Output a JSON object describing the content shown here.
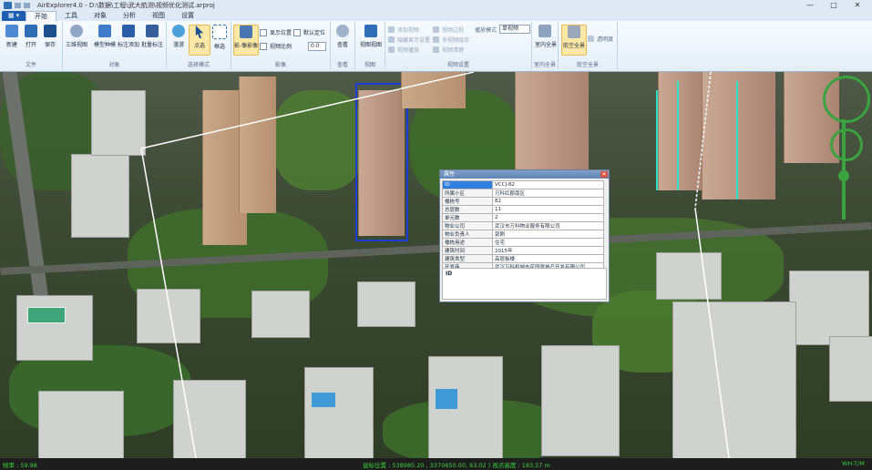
{
  "window": {
    "title": "AirExplorer4.0 - D:\\数据\\工程\\武大航测\\视频优化测试.arproj",
    "minimize": "—",
    "maximize": "□",
    "close": "✕"
  },
  "menu": {
    "file": "▦ ▾",
    "tabs": [
      "开始",
      "工具",
      "对象",
      "分析",
      "视图",
      "设置"
    ]
  },
  "ribbon": {
    "groups": {
      "file": "文件",
      "object": "对象",
      "select_mode": "选择模式",
      "image": "影像",
      "view": "查看",
      "viewpoint": "视图",
      "view_settings": "视频设置",
      "indoor": "室内全景",
      "aerial": "航空全景"
    },
    "buttons": {
      "new": "新建",
      "open": "打开",
      "save": "保存",
      "3d_view": "三维视图",
      "model_wire": "模型种模",
      "label_add": "标注添加",
      "batch_label": "批量标注",
      "roam": "漫游",
      "point_select": "点选",
      "frame_select": "框选",
      "image_mosaic": "影-像影像",
      "view_btn": "查看",
      "view_view": "视图视图",
      "indoor_pano": "室内全景",
      "aerial_pano": "航空全景",
      "transparent": "透明度"
    },
    "checks": {
      "show_position": "显示位置",
      "default_position": "默认定位",
      "view_scale": "视频比例"
    },
    "spin_value": "0.0",
    "view_settings_items": [
      "添加视频",
      "隐藏显示设置",
      "视频播放",
      "视频过程",
      "多视频组合",
      "视频清理",
      "播放模式"
    ],
    "play_mode": "单视频"
  },
  "popup": {
    "title": "属性",
    "close": "✕",
    "rows": [
      {
        "k": "ID",
        "v": "VCCJ-82",
        "highlight": true
      },
      {
        "k": "所属小区",
        "v": "万科红郡南区"
      },
      {
        "k": "楼栋号",
        "v": "82"
      },
      {
        "k": "总层数",
        "v": "11"
      },
      {
        "k": "单元数",
        "v": "2"
      },
      {
        "k": "物业公司",
        "v": "武汉市万科物业服务有限公司"
      },
      {
        "k": "物业负责人",
        "v": "郭刚"
      },
      {
        "k": "楼栋用途",
        "v": "住宅"
      },
      {
        "k": "建筑时间",
        "v": "2015年"
      },
      {
        "k": "建筑类型",
        "v": "高层板楼"
      },
      {
        "k": "开发商",
        "v": "武汉万科和城市花园房地产开发有限公司"
      }
    ],
    "desc_label": "ID"
  },
  "status": {
    "fps": "帧率 : 59.98",
    "position": "鼠标位置 : 538985.20 , 3370650.00, 63.02 ) 视点高度 : 183.57 m",
    "coord_sys": "WH-T/M"
  }
}
